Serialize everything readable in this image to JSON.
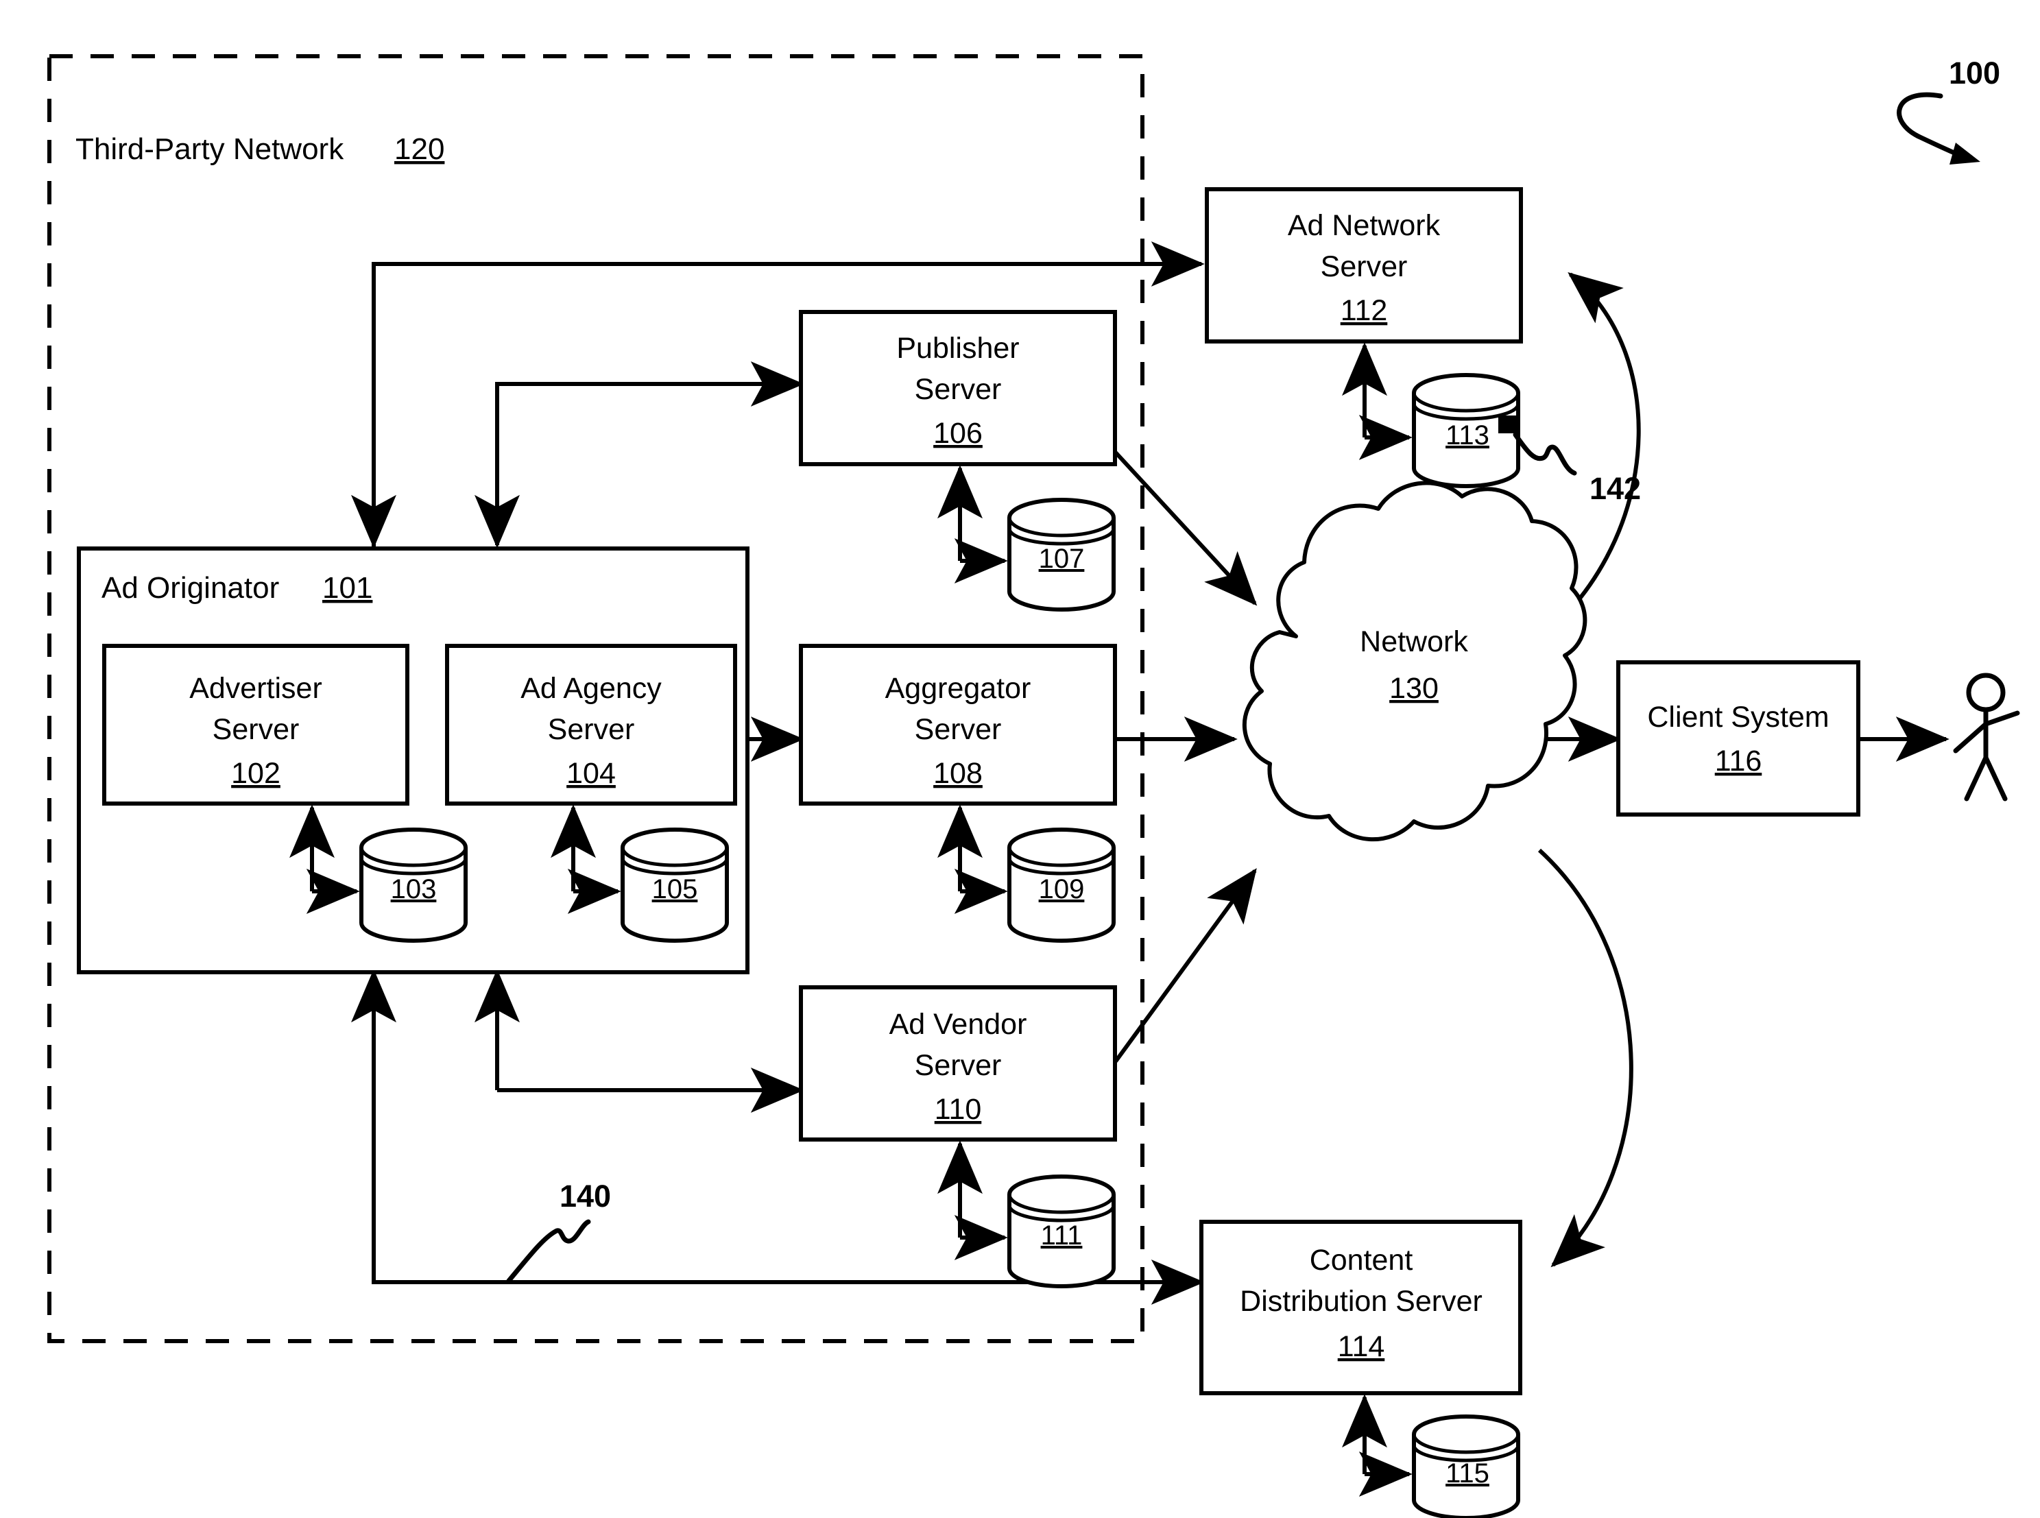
{
  "figure": {
    "reference_numeral": "100",
    "type": "patent-system-block-diagram"
  },
  "regions": {
    "third_party_network": {
      "label": "Third-Party Network",
      "numeral": "120"
    },
    "ad_originator": {
      "label": "Ad Originator",
      "numeral": "101"
    }
  },
  "nodes": {
    "advertiser_server": {
      "line1": "Advertiser",
      "line2": "Server",
      "numeral": "102"
    },
    "ad_agency_server": {
      "line1": "Ad Agency",
      "line2": "Server",
      "numeral": "104"
    },
    "publisher_server": {
      "line1": "Publisher",
      "line2": "Server",
      "numeral": "106"
    },
    "aggregator_server": {
      "line1": "Aggregator",
      "line2": "Server",
      "numeral": "108"
    },
    "ad_vendor_server": {
      "line1": "Ad Vendor",
      "line2": "Server",
      "numeral": "110"
    },
    "ad_network_server": {
      "line1": "Ad Network",
      "line2": "Server",
      "numeral": "112"
    },
    "content_distribution_server": {
      "line1": "Content",
      "line2": "Distribution Server",
      "numeral": "114"
    },
    "client_system": {
      "line1": "Client System",
      "numeral": "116"
    },
    "network_cloud": {
      "line1": "Network",
      "numeral": "130"
    }
  },
  "databases": {
    "advertiser_db": "103",
    "ad_agency_db": "105",
    "publisher_db": "107",
    "aggregator_db": "109",
    "ad_vendor_db": "111",
    "ad_network_db": "113",
    "content_distribution_db": "115"
  },
  "callouts": {
    "feedback_path": "140",
    "tracking_path": "142"
  },
  "colors": {
    "stroke": "#000000",
    "background": "#ffffff"
  }
}
